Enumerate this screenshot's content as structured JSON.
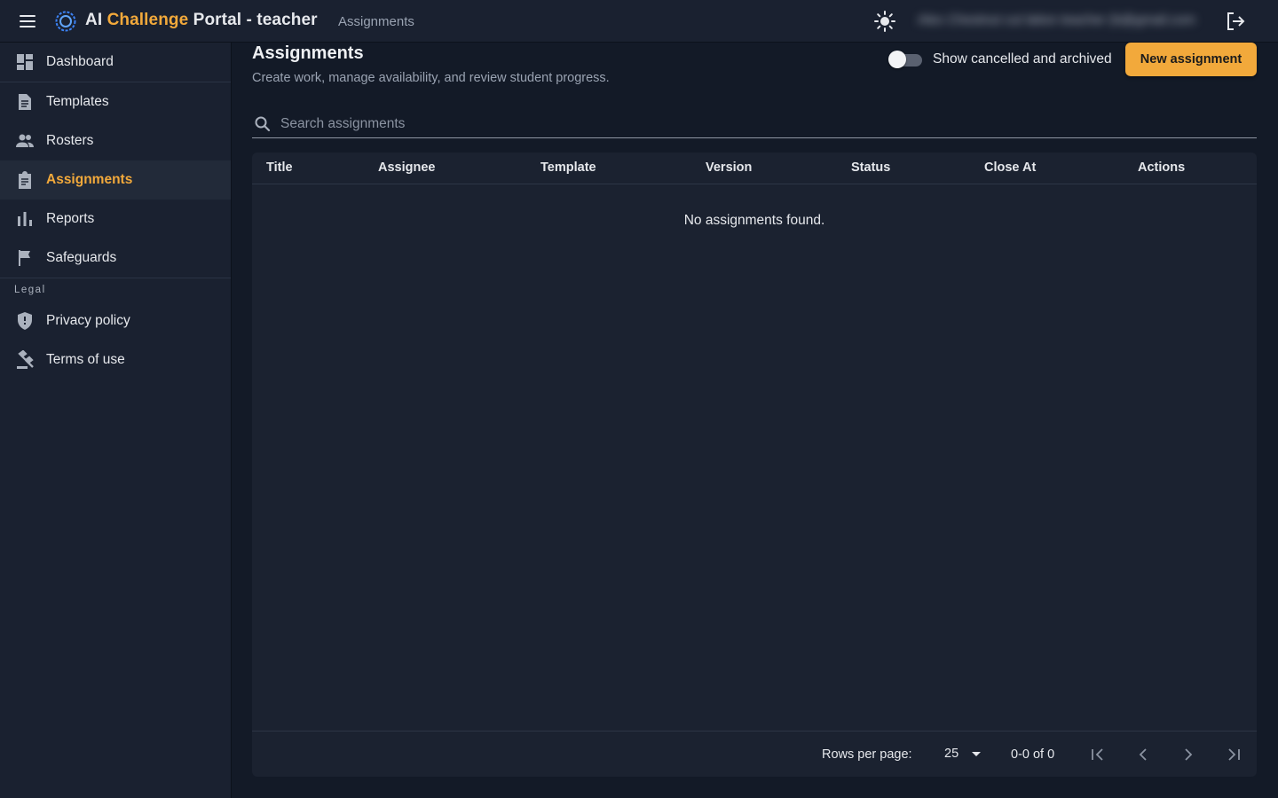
{
  "header": {
    "app_title_prefix": "AI ",
    "app_title_accent": "Challenge",
    "app_title_suffix": " Portal - teacher",
    "breadcrumb": "Assignments",
    "user_email": "Alex Chestnut cut lation teacher (b@gmail.com",
    "icons": {
      "menu": "menu-icon",
      "logo": "logo-icon",
      "theme": "sun-icon",
      "logout": "logout-icon"
    }
  },
  "sidebar": {
    "items": [
      {
        "label": "Dashboard",
        "icon": "dashboard-icon"
      },
      {
        "label": "Templates",
        "icon": "document-icon"
      },
      {
        "label": "Rosters",
        "icon": "people-icon"
      },
      {
        "label": "Assignments",
        "icon": "clipboard-icon",
        "active": true
      },
      {
        "label": "Reports",
        "icon": "bar-chart-icon"
      },
      {
        "label": "Safeguards",
        "icon": "flag-icon"
      }
    ],
    "legal_label": "Legal",
    "legal_items": [
      {
        "label": "Privacy policy",
        "icon": "shield-icon"
      },
      {
        "label": "Terms of use",
        "icon": "gavel-icon"
      }
    ]
  },
  "main": {
    "title": "Assignments",
    "subtitle": "Create work, manage availability, and review student progress.",
    "toggle_label": "Show cancelled and archived",
    "toggle_on": false,
    "new_button": "New assignment",
    "search_placeholder": "Search assignments",
    "search_value": "",
    "columns": [
      "Title",
      "Assignee",
      "Template",
      "Version",
      "Status",
      "Close At",
      "Actions"
    ],
    "rows": [],
    "empty_message": "No assignments found.",
    "pagination": {
      "rows_per_page_label": "Rows per page:",
      "rows_per_page": "25",
      "range": "0-0 of 0"
    }
  },
  "colors": {
    "accent": "#f2a93b",
    "background": "#131a27",
    "surface": "#1a2130"
  }
}
